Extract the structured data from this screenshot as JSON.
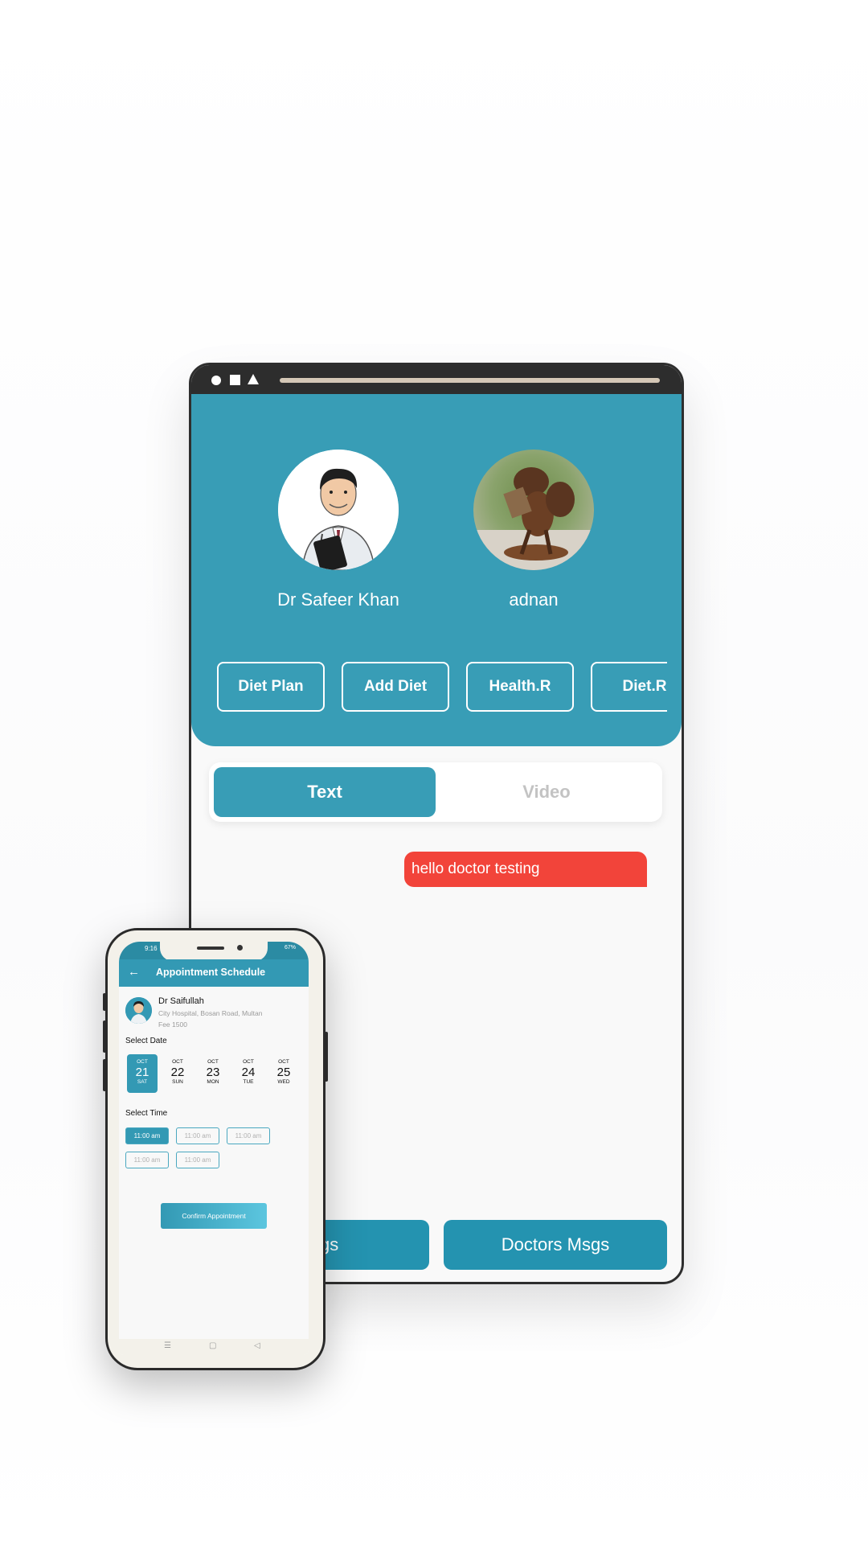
{
  "tablet": {
    "doctor_name": "Dr Safeer Khan",
    "user_name": "adnan",
    "chips": [
      "Diet Plan",
      "Add Diet",
      "Health.R",
      "Diet.R"
    ],
    "segments": {
      "active": "Text",
      "inactive": "Video"
    },
    "message": "hello doctor testing",
    "bottom_buttons": {
      "patients": "Msgs",
      "doctors": "Doctors Msgs"
    },
    "colors": {
      "primary": "#389db6",
      "bubble": "#f2443a",
      "button": "#2493b0"
    }
  },
  "phone": {
    "time": "9:16",
    "signal": "67%",
    "title": "Appointment Schedule",
    "back_icon": "arrow-left-icon",
    "doctor": {
      "name": "Dr Saifullah",
      "address": "City Hospital, Bosan Road, Multan",
      "fee": "Fee 1500"
    },
    "select_date_label": "Select Date",
    "dates": [
      {
        "month": "OCT",
        "day": "21",
        "weekday": "SAT"
      },
      {
        "month": "OCT",
        "day": "22",
        "weekday": "SUN"
      },
      {
        "month": "OCT",
        "day": "23",
        "weekday": "MON"
      },
      {
        "month": "OCT",
        "day": "24",
        "weekday": "TUE"
      },
      {
        "month": "OCT",
        "day": "25",
        "weekday": "WED"
      }
    ],
    "selected_date_index": 0,
    "select_time_label": "Select Time",
    "times": [
      "11:00 am",
      "11:00 am",
      "11:00 am",
      "11:00 am",
      "11:00 am"
    ],
    "selected_time_index": 0,
    "confirm_label": "Confirm Appointment",
    "nav": {
      "menu": "☰",
      "home": "▢",
      "back": "◁"
    }
  }
}
